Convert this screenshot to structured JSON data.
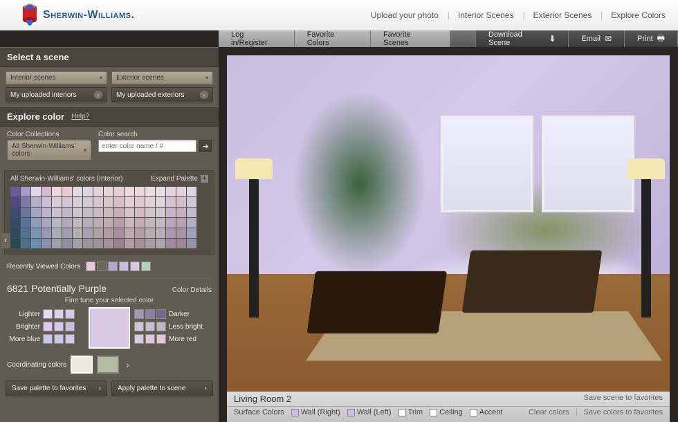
{
  "brand": "Sherwin-Williams.",
  "nav": {
    "upload": "Upload your photo",
    "interior": "Interior Scenes",
    "exterior": "Exterior Scenes",
    "explore": "Explore Colors"
  },
  "toolbar": {
    "login": "Log in/Register",
    "favc": "Favorite Colors",
    "favs": "Favorite Scenes",
    "download": "Download Scene",
    "email": "Email",
    "print": "Print"
  },
  "sidebar": {
    "scene_head": "Select a scene",
    "dd_interior": "Interior scenes",
    "dd_exterior": "Exterior scenes",
    "up_int": "My uploaded interiors",
    "up_ext": "My uploaded exteriors",
    "explore_head": "Explore color",
    "help": "Help?",
    "collections_lbl": "Color Collections",
    "collections_dd": "All Sherwin-Williams' colors",
    "search_lbl": "Color search",
    "search_ph": "enter color name / #",
    "pal_title": "All Sherwin-Williams' colors (Interior)",
    "expand": "Expand Palette",
    "recent_lbl": "Recently Viewed Colors",
    "sel_name": "6821 Potentially Purple",
    "details": "Color Details",
    "fine_tune": "Fine tune your selected color",
    "lighter": "Lighter",
    "darker": "Darker",
    "brighter": "Brighter",
    "less_bright": "Less bright",
    "more_blue": "More blue",
    "more_red": "More red",
    "coord_lbl": "Coordinating colors",
    "save_pal": "Save palette to favorites",
    "apply_pal": "Apply palette to scene"
  },
  "footer": {
    "scene_name": "Living Room 2",
    "save_scene": "Save scene to favorites",
    "surface_lbl": "Surface Colors",
    "s1": "Wall (Right)",
    "s2": "Wall (Left)",
    "s3": "Trim",
    "s4": "Ceiling",
    "s5": "Accent",
    "clear": "Clear colors",
    "save_colors": "Save colors to favorites"
  },
  "colors": {
    "selected": "#d7c9e4",
    "recent": [
      "#eac8e0",
      "#6d665b",
      "#b6a9cf",
      "#cabde0",
      "#d7c9e4",
      "#b9cdbf"
    ],
    "lighter": [
      "#e5dbef",
      "#ddd1ea",
      "#d7c9e4"
    ],
    "darker": [
      "#a599b6",
      "#8d81a0",
      "#746889"
    ],
    "brighter": [
      "#e0c6ee",
      "#d9c8eb",
      "#cdbde4"
    ],
    "less_bright": [
      "#cfc5d9",
      "#c6bfcc",
      "#bdb9bf"
    ],
    "more_blue": [
      "#c6c9ea",
      "#ccc9e6",
      "#d2c9e5"
    ],
    "more_red": [
      "#dac9e0",
      "#e0c9db",
      "#e6c9d6"
    ],
    "coord": [
      "#eceadf",
      "#b4bba1"
    ],
    "s1": "#cdbde4",
    "s2": "#cdbde4",
    "palette": [
      "#6b5aa0",
      "#a79acb",
      "#e3d6e9",
      "#d6b8d4",
      "#e9d6de",
      "#e9cbd5",
      "#e1d8e2",
      "#e0d6df",
      "#e2d1dd",
      "#e4d5dd",
      "#e4cdd7",
      "#ecd9df",
      "#edd6dc",
      "#eadde2",
      "#e7dee4",
      "#e1d3de",
      "#e0d1da",
      "#dcd5e1",
      "#4e4a80",
      "#7c79a8",
      "#b3afd1",
      "#c9c0d8",
      "#d6cbdd",
      "#d3c4d7",
      "#d7cdd9",
      "#d4cad5",
      "#d6c6d2",
      "#d7c7d1",
      "#d6bdc9",
      "#e4cdd5",
      "#e1c7cf",
      "#ded1d7",
      "#dbd4da",
      "#d3c3d2",
      "#d1c1cd",
      "#cec8d7",
      "#3d4a78",
      "#6a75a0",
      "#a0a6c6",
      "#b9b3cc",
      "#c8c1d0",
      "#c2b7c9",
      "#cac4cc",
      "#c5bcc7",
      "#c9bac4",
      "#cab9c3",
      "#c7adba",
      "#d8c2ca",
      "#d3b9c1",
      "#d1c5cb",
      "#cec8cf",
      "#c5b5c7",
      "#c3b1bf",
      "#bfbccd",
      "#344a6c",
      "#5d7298",
      "#8d9dbd",
      "#a8a6c1",
      "#b9b7c4",
      "#b1aabd",
      "#bdb9c0",
      "#b6aebb",
      "#bbadb6",
      "#bdabb4",
      "#b99dac",
      "#ccb6bf",
      "#c5abb3",
      "#c3b8bf",
      "#c1bcc4",
      "#b7a7bc",
      "#b5a3b2",
      "#b0afc3",
      "#2d4a60",
      "#547190",
      "#7b95b5",
      "#979ab7",
      "#aaadb8",
      "#a19db1",
      "#b0aeb3",
      "#a8a1af",
      "#ada0a9",
      "#af9ea6",
      "#ab8e9d",
      "#c0aab3",
      "#b79da5",
      "#b6acb2",
      "#b4b0b9",
      "#a898b0",
      "#a795a5",
      "#a1a2b8",
      "#264a54",
      "#4b7088",
      "#6a8ead",
      "#8790ad",
      "#9ba3ad",
      "#9190a4",
      "#a3a3a7",
      "#9994a2",
      "#9f939c",
      "#a29199",
      "#9d808f",
      "#b49da7",
      "#a98f97",
      "#a8a0a6",
      "#a7a4ad",
      "#9a8aa4",
      "#998798",
      "#9395ae"
    ]
  }
}
